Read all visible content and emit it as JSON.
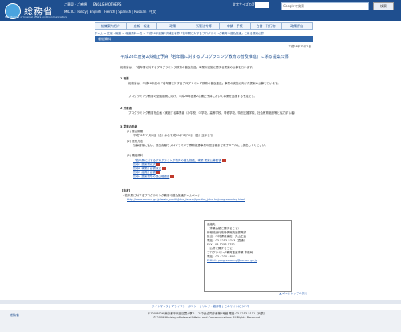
{
  "header": {
    "logo_text": "総務省",
    "logo_sub": "MIC Ministry of Internal Affairs and Communications",
    "links": [
      "ご意見・ご感想",
      "ENGLISH/OTHERS",
      "MIC ICT Policy",
      "English | French | Spanish | Russian | 中文"
    ],
    "font_size_label": "文字サイズの変更",
    "search_placeholder": "Googleで検索",
    "search_button": "検索"
  },
  "nav": {
    "items": [
      "組織案内紹介",
      "広報・報道",
      "政策",
      "所管法令等",
      "申請・手続",
      "白書・刊行物",
      "政策評価"
    ]
  },
  "breadcrumb": "ホーム > 広報・報道 > 報道資料一覧 > 平成28年度第2次補正予算「若年層に対するプログラミング教育の普及推進」に係る提案公募",
  "banner": "報道資料",
  "date": "平成28年12月2日",
  "main": {
    "title": "平成28年度第2次補正予算「若年層に対するプログラミング教育の普及推進」に係る提案公募",
    "intro": "総務省は、「若年層に対するプログラミング教育の普及推進」事業の実施に関する提案の公募を行います。",
    "section1_heading": "1 概要",
    "section1_text1": "総務省は、平成28年度の「若年層に対するプログラミング教育の普及推進」事業の実施に向けた提案の公募を行います。",
    "section1_text2": "プログラミング教育の全国展開に向け、平成28年度第2次補正予算において事業を実施する予定です。",
    "section2_heading": "2 対象者",
    "section2_text": "プログラミング教育を企画・実施する事業者（小学校、中学校、高等学校、専修学校、特別支援学校、社会教育施設等と協力する者）",
    "section3_heading": "3 提案の手続",
    "section3_sub1": "(1) 提出期間",
    "section3_sub1_text": "平成28年12月2日（金）から平成29年1月20日（金）正午まで",
    "section3_sub2": "(2) 提案方法",
    "section3_sub2_text": "公募要領に従い、提出書類をプログラミング教育推進事業の担当者まで電子メールにて提出してください。",
    "section3_sub3": "(3) 関連資料",
    "docs": [
      "「若年層に対するプログラミング教育の普及推進」事業 提案公募要領",
      "別添1 提案書様式",
      "別添2 事業計画書様式",
      "別添3 経費計画書",
      "別添4 提案書等の提出確認書"
    ],
    "ref_heading": "【参考】",
    "ref_text": "・若年層に対するプログラミング教育の普及推進ホームページ",
    "ref_url": "http://www.soumu.go.jp/main_sosiki/joho_tsusin/kyouiku_joho-ka/programming.html"
  },
  "contact": {
    "heading": "連絡先",
    "lines": [
      "（事業全般に関すること）",
      "情報流通行政局情報流通振興課",
      "担当：中村課長補佐、丸山主査",
      "電話：03-5253-5743（直通）",
      "FAX：03-5253-5752",
      "（公募に関すること）",
      "プログラミング教育推進事業 事務局",
      "電話：03-4230-4890",
      "E-Mail：programming@soumu.go.jp"
    ]
  },
  "page_top": "▲ ページトップへ戻る",
  "footer": {
    "links": [
      "サイトマップ",
      "プライバシーポリシー",
      "リンク・著作権",
      "このサイトについて"
    ],
    "logo": "総務省",
    "address": "〒100-8926 東京都千代田区霞が関2-1-2 中央合同庁舎第2号館 電話 03-5253-5111（代表）",
    "copyright": "© 2009 Ministry of Internal Affairs and Communications All Rights Reserved."
  }
}
